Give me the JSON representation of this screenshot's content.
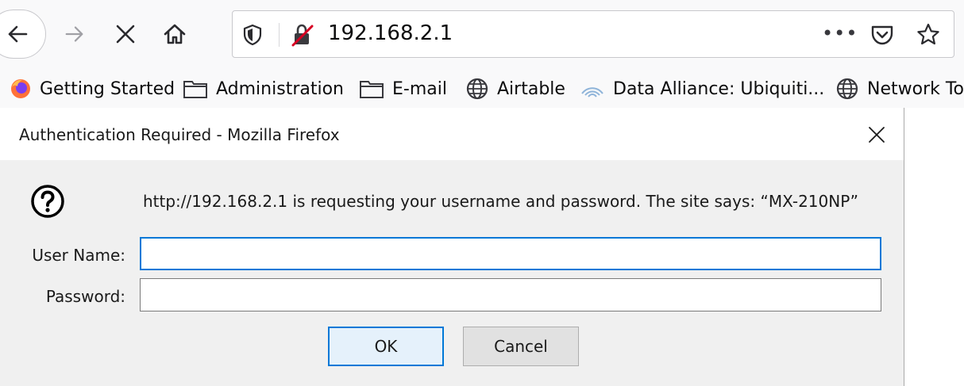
{
  "browser": {
    "url": "192.168.2.1",
    "page_actions_label": "•••"
  },
  "bookmarks": [
    {
      "label": "Getting Started",
      "icon": "firefox-icon"
    },
    {
      "label": "Administration",
      "icon": "folder-icon"
    },
    {
      "label": "E-mail",
      "icon": "folder-icon"
    },
    {
      "label": "Airtable",
      "icon": "globe-icon"
    },
    {
      "label": "Data Alliance: Ubiquiti...",
      "icon": "wifi-icon"
    },
    {
      "label": "Network To",
      "icon": "globe-icon"
    }
  ],
  "dialog": {
    "title": "Authentication Required - Mozilla Firefox",
    "message": "http://192.168.2.1 is requesting your username and password. The site says: “MX-210NP”",
    "username_label": "User Name:",
    "username_value": "",
    "password_label": "Password:",
    "password_value": "",
    "ok_label": "OK",
    "cancel_label": "Cancel"
  },
  "colors": {
    "focus_blue": "#0078d7",
    "dialog_bg": "#f0f0f0",
    "toolbar_bg": "#f9f9fa"
  }
}
